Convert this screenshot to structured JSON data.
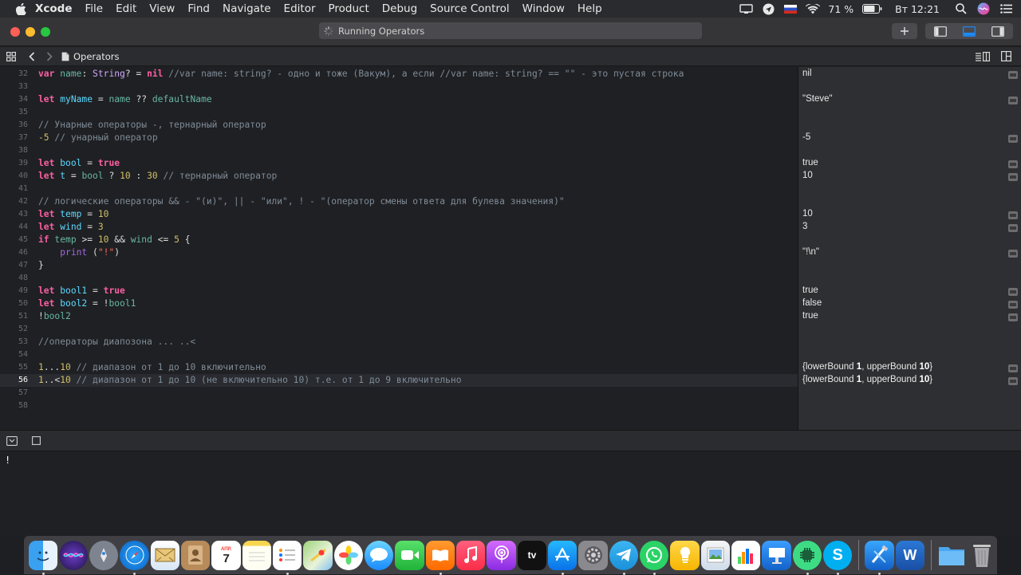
{
  "menubar": {
    "app": "Xcode",
    "items": [
      "File",
      "Edit",
      "View",
      "Find",
      "Navigate",
      "Editor",
      "Product",
      "Debug",
      "Source Control",
      "Window",
      "Help"
    ],
    "battery": "71 %",
    "clock": "Вт 12:21"
  },
  "window": {
    "activity": "Running Operators",
    "file": "Operators"
  },
  "editor": {
    "lines": [
      {
        "n": "32"
      },
      {
        "n": "33"
      },
      {
        "n": "34"
      },
      {
        "n": "35"
      },
      {
        "n": "36"
      },
      {
        "n": "37"
      },
      {
        "n": "38"
      },
      {
        "n": "39"
      },
      {
        "n": "40"
      },
      {
        "n": "41"
      },
      {
        "n": "42"
      },
      {
        "n": "43"
      },
      {
        "n": "44"
      },
      {
        "n": "45"
      },
      {
        "n": "46"
      },
      {
        "n": "47"
      },
      {
        "n": "48"
      },
      {
        "n": "49"
      },
      {
        "n": "50"
      },
      {
        "n": "51"
      },
      {
        "n": "52"
      },
      {
        "n": "53"
      },
      {
        "n": "54"
      },
      {
        "n": "55"
      },
      {
        "n": "56"
      },
      {
        "n": "57"
      },
      {
        "n": "58"
      }
    ],
    "tokens": {
      "l32_kw": "var",
      "l32_a": " ",
      "l32_id": "name",
      "l32_b": ": ",
      "l32_ty": "String",
      "l32_c": "? = ",
      "l32_nil": "nil",
      "l32_cmt": " //var name: string? - одно и тоже (Вакум), а если //var name: string? == \"\" - это пустая строка",
      "l34_kw": "let",
      "l34_a": " ",
      "l34_id": "myName",
      "l34_b": " = ",
      "l34_id2": "name",
      "l34_c": " ?? ",
      "l34_id3": "defaultName",
      "l36_cmt": "// Унарные операторы -, тернарный оператор",
      "l37_num": "-5",
      "l37_cmt": " // унарный оператор",
      "l39_kw": "let",
      "l39_a": " ",
      "l39_id": "bool",
      "l39_b": " = ",
      "l39_true": "true",
      "l40_kw": "let",
      "l40_a": " ",
      "l40_id": "t",
      "l40_b": " = ",
      "l40_id2": "bool",
      "l40_c": " ? ",
      "l40_n1": "10",
      "l40_d": " : ",
      "l40_n2": "30",
      "l40_cmt": " // тернарный оператор",
      "l42_cmt": "// логические операторы && - \"(и)\", || - \"или\", ! - \"(оператор смены ответа для булева значения)\"",
      "l43_kw": "let",
      "l43_a": " ",
      "l43_id": "temp",
      "l43_b": " = ",
      "l43_num": "10",
      "l44_kw": "let",
      "l44_a": " ",
      "l44_id": "wind",
      "l44_b": " = ",
      "l44_num": "3",
      "l45_kw": "if",
      "l45_a": " ",
      "l45_id": "temp",
      "l45_b": " >= ",
      "l45_n1": "10",
      "l45_c": " && ",
      "l45_id2": "wind",
      "l45_d": " <= ",
      "l45_n2": "5",
      "l45_e": " {",
      "l46_indent": "    ",
      "l46_fn": "print",
      "l46_a": " (",
      "l46_str": "\"!\"",
      "l46_b": ")",
      "l47_brace": "}",
      "l49_kw": "let",
      "l49_a": " ",
      "l49_id": "bool1",
      "l49_b": " = ",
      "l49_true": "true",
      "l50_kw": "let",
      "l50_a": " ",
      "l50_id": "bool2",
      "l50_b": " = !",
      "l50_id2": "bool1",
      "l51_a": "!",
      "l51_id": "bool2",
      "l53_cmt": "//операторы диапозона ... ..<",
      "l55_n1": "1",
      "l55_op": "...",
      "l55_n2": "10",
      "l55_cmt": " // диапазон от 1 до 10 включительно",
      "l56_n1": "1",
      "l56_op": "..<",
      "l56_n2": "10",
      "l56_cmt": " // диапазон от 1 до 10 (не включительно 10) т.е. от 1 до 9 включительно"
    }
  },
  "results": {
    "r32": "nil",
    "r34": "\"Steve\"",
    "r37": "-5",
    "r39": "true",
    "r40": "10",
    "r43": "10",
    "r44": "3",
    "r46": "\"!\\n\"",
    "r49": "true",
    "r50": "false",
    "r51": "true",
    "r55_a": "{lowerBound ",
    "r55_b": "1",
    "r55_c": ", upperBound ",
    "r55_d": "10",
    "r55_e": "}",
    "r56_a": "{lowerBound ",
    "r56_b": "1",
    "r56_c": ", upperBound ",
    "r56_d": "10",
    "r56_e": "}"
  },
  "console": {
    "output": "!"
  },
  "dock": {
    "apps": [
      "finder-icon",
      "siri-icon",
      "launchpad-icon",
      "safari-icon",
      "mail-icon",
      "contacts-icon",
      "calendar-icon",
      "notes-icon",
      "reminders-icon",
      "maps-icon",
      "photos-icon",
      "messages-icon",
      "facetime-icon",
      "books-icon",
      "music-icon",
      "podcasts-icon",
      "tv-icon",
      "app-store-icon",
      "system-preferences-icon",
      "telegram-icon",
      "whatsapp-icon",
      "tips-icon",
      "preview-icon",
      "numbers-icon",
      "keynote-icon",
      "android-tool-icon",
      "skype-icon",
      "xcode-icon",
      "word-icon",
      "downloads-folder-icon",
      "trash-icon"
    ],
    "calendar_day": "7",
    "calendar_month": "АПР."
  },
  "colors": {
    "keyword": "#fc5fa3",
    "identifier": "#67b7a4",
    "number": "#d0bf69",
    "comment": "#7f8c98",
    "string": "#fc6a5d"
  }
}
